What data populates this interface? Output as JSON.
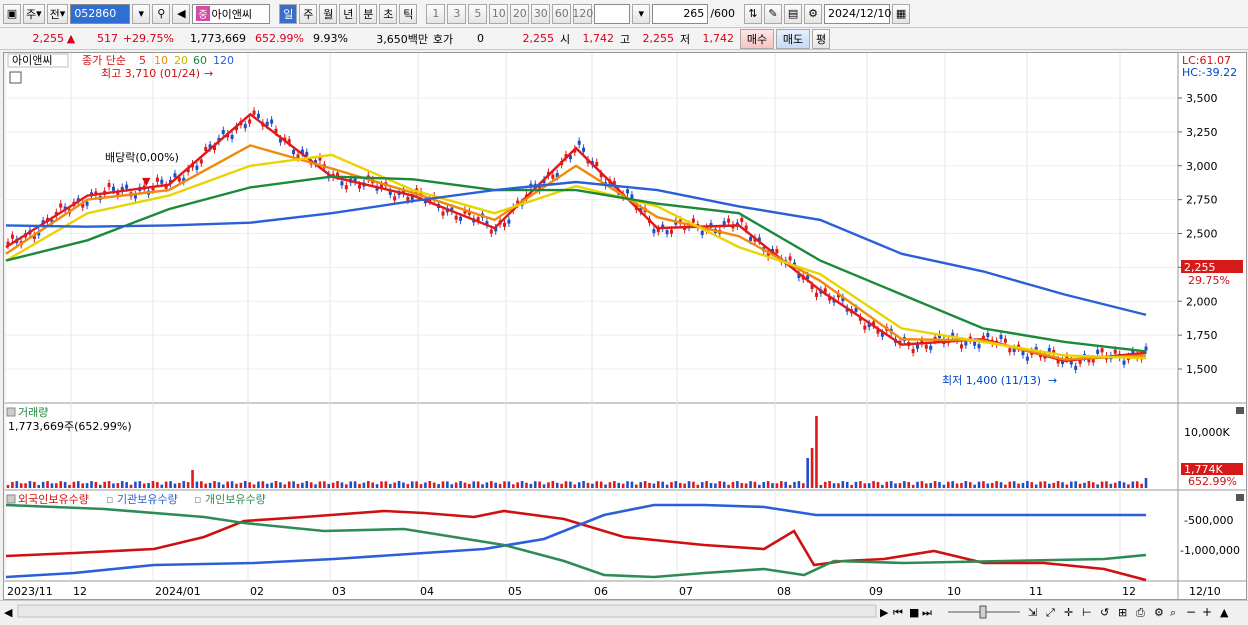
{
  "toolbar": {
    "type_select": "주",
    "scope_select": "전",
    "stock_code": "052860",
    "stock_badge": "중",
    "stock_name": "아이앤씨",
    "periods": [
      "일",
      "주",
      "월",
      "년",
      "분",
      "초",
      "틱"
    ],
    "active_period": "일",
    "intervals": [
      "1",
      "3",
      "5",
      "10",
      "20",
      "30",
      "60",
      "120"
    ],
    "count_value": "265",
    "count_max": "/600",
    "date": "2024/12/10"
  },
  "infobar": {
    "price": "2,255",
    "arrow": "▲",
    "change": "517",
    "change_pct": "+29.75%",
    "volume": "1,773,669",
    "vol_ratio": "652.99%",
    "turnover": "9.93%",
    "amount": "3,650백만",
    "hoga_label": "호가",
    "hoga_value": "0",
    "hoga_price": "2,255",
    "open_label": "시",
    "open": "1,742",
    "high_label": "고",
    "high": "2,255",
    "low_label": "저",
    "low": "1,742",
    "buy_btn": "매수",
    "sell_btn": "매도",
    "eval_btn": "평"
  },
  "main_chart": {
    "stock_label": "아이앤씨",
    "ma_label": "종가 단순",
    "ma_periods": [
      "5",
      "10",
      "20",
      "60",
      "120"
    ],
    "ma_colors": [
      "#e0191b",
      "#f08a0a",
      "#e8d400",
      "#1a8a3a",
      "#2a5fd7"
    ],
    "max_label": "최고 3,710 (01/24)",
    "min_label": "최저 1,400 (11/13)",
    "dividend_label": "배당락(0,00%)",
    "lc_label": "LC:61.07",
    "hc_label": "HC:-39.22",
    "last_price_tag": "2,255",
    "last_pct_tag": "29.75%",
    "y_ticks": [
      "3,500",
      "3,250",
      "3,000",
      "2,750",
      "2,500",
      "2,250",
      "2,000",
      "1,750",
      "1,500"
    ]
  },
  "volume_chart": {
    "title": "거래량",
    "subtitle": "1,773,669주(652.99%)",
    "y_tick": "10,000K",
    "tag_value": "1,774K",
    "tag_pct": "652.99%"
  },
  "holders_chart": {
    "legend": [
      "외국인보유수량",
      "기관보유수량",
      "개인보유수량"
    ],
    "legend_colors": [
      "#d01010",
      "#2a5fd7",
      "#2e8b57"
    ],
    "y_ticks": [
      "-500,000",
      "-1,000,000"
    ]
  },
  "x_axis": {
    "labels": [
      "2023/11",
      "12",
      "2024/01",
      "02",
      "03",
      "04",
      "05",
      "06",
      "07",
      "08",
      "09",
      "10",
      "11",
      "12",
      "12/10"
    ]
  },
  "chart_data": {
    "type": "line",
    "title": "",
    "ylim": [
      1400,
      3700
    ],
    "x": [
      "2023/11",
      "12",
      "2024/01",
      "02",
      "03",
      "04",
      "05",
      "06",
      "07",
      "08",
      "09",
      "10",
      "11",
      "12"
    ],
    "series": [
      {
        "name": "5",
        "values": [
          2400,
          2780,
          2860,
          3380,
          2920,
          2780,
          2540,
          3130,
          2540,
          2560,
          2080,
          1680,
          1720,
          1560,
          1620
        ]
      },
      {
        "name": "10",
        "values": [
          2350,
          2750,
          2820,
          3150,
          2980,
          2800,
          2600,
          3000,
          2620,
          2480,
          2150,
          1720,
          1710,
          1570,
          1600
        ]
      },
      {
        "name": "20",
        "values": [
          2300,
          2650,
          2780,
          3000,
          3080,
          2820,
          2650,
          2850,
          2700,
          2400,
          2200,
          1800,
          1700,
          1600,
          1580
        ]
      },
      {
        "name": "60",
        "values": [
          2300,
          2450,
          2680,
          2840,
          2920,
          2900,
          2820,
          2820,
          2720,
          2650,
          2300,
          2050,
          1800,
          1700,
          1630
        ]
      },
      {
        "name": "120",
        "values": [
          2560,
          2550,
          2560,
          2580,
          2650,
          2740,
          2820,
          2880,
          2820,
          2700,
          2600,
          2350,
          2220,
          2050,
          1900
        ]
      }
    ]
  }
}
